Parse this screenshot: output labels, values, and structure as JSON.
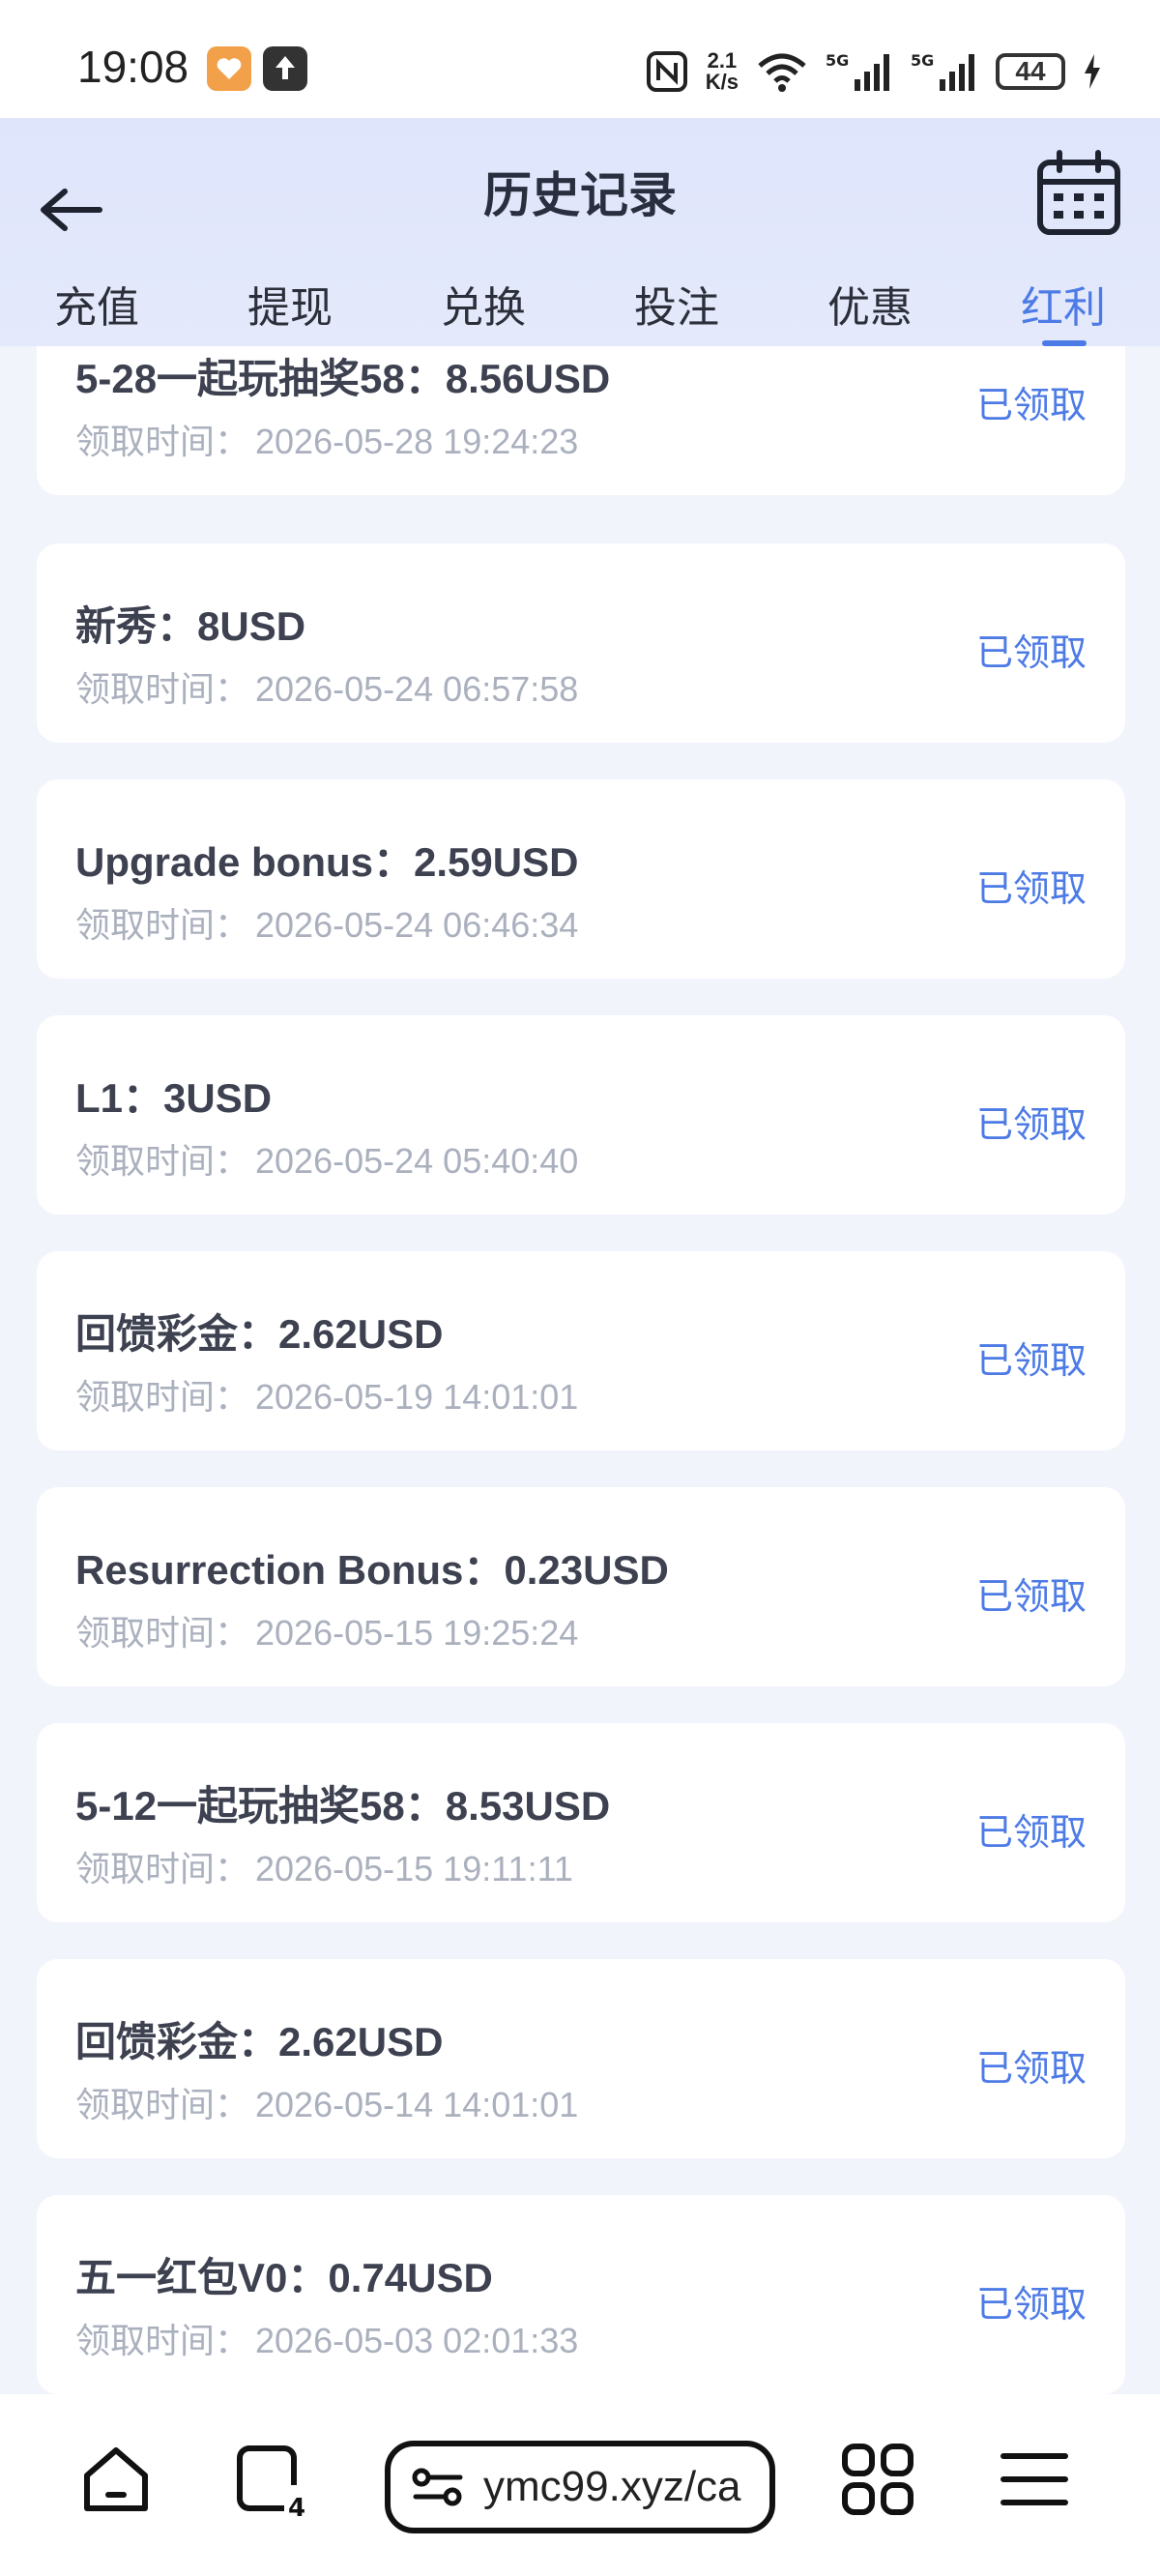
{
  "status_bar": {
    "time": "19:08",
    "net_speed_value": "2.1",
    "net_speed_unit": "K/s",
    "battery": "44",
    "icons": [
      "health-app-icon",
      "upload-icon",
      "nfc-icon",
      "wifi-icon",
      "signal-5g-icon",
      "signal-5g-icon",
      "battery-icon",
      "charging-icon"
    ]
  },
  "header": {
    "title": "历史记录",
    "tabs": [
      {
        "label": "充值"
      },
      {
        "label": "提现"
      },
      {
        "label": "兑换"
      },
      {
        "label": "投注"
      },
      {
        "label": "优惠"
      },
      {
        "label": "红利"
      }
    ],
    "active_tab": "红利"
  },
  "records": [
    {
      "title": "5-28一起玩抽奖58：8.56USD",
      "time_label": "领取时间：",
      "time": "2026-05-28 19:24:23",
      "status": "已领取"
    },
    {
      "title": "新秀：8USD",
      "time_label": "领取时间：",
      "time": "2026-05-24 06:57:58",
      "status": "已领取"
    },
    {
      "title": "Upgrade bonus：2.59USD",
      "time_label": "领取时间：",
      "time": "2026-05-24 06:46:34",
      "status": "已领取"
    },
    {
      "title": "L1：3USD",
      "time_label": "领取时间：",
      "time": "2026-05-24 05:40:40",
      "status": "已领取"
    },
    {
      "title": "回馈彩金：2.62USD",
      "time_label": "领取时间：",
      "time": "2026-05-19 14:01:01",
      "status": "已领取"
    },
    {
      "title": "Resurrection Bonus：0.23USD",
      "time_label": "领取时间：",
      "time": "2026-05-15 19:25:24",
      "status": "已领取"
    },
    {
      "title": "5-12一起玩抽奖58：8.53USD",
      "time_label": "领取时间：",
      "time": "2026-05-15 19:11:11",
      "status": "已领取"
    },
    {
      "title": "回馈彩金：2.62USD",
      "time_label": "领取时间：",
      "time": "2026-05-14 14:01:01",
      "status": "已领取"
    },
    {
      "title": "五一红包V0：0.74USD",
      "time_label": "领取时间：",
      "time": "2026-05-03 02:01:33",
      "status": "已领取"
    }
  ],
  "browser": {
    "url": "ymc99.xyz/ca",
    "tab_count": "4"
  },
  "colors": {
    "accent": "#4d7be6",
    "header_bg": "#dfe5fb",
    "page_bg": "#f2f4fb"
  }
}
